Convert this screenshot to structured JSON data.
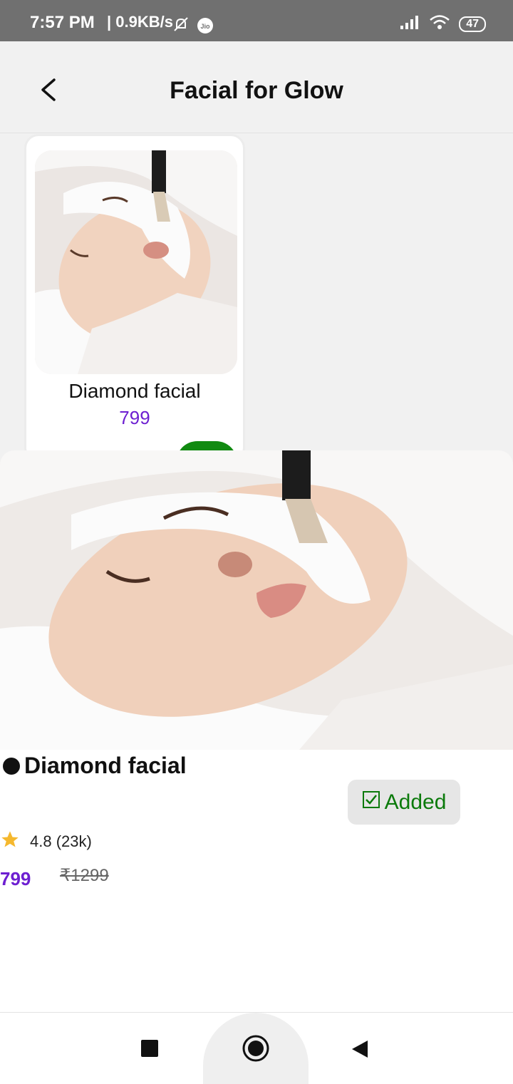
{
  "status_bar": {
    "time": "7:57 PM",
    "network_speed": "| 0.9KB/s",
    "battery": "47"
  },
  "app_bar": {
    "title": "Facial for Glow"
  },
  "service_card": {
    "name": "Diamond facial",
    "price": "799"
  },
  "detail": {
    "name": "Diamond facial",
    "added_label": "Added",
    "rating": "4.8 (23k)",
    "price": "799",
    "original_price": "₹1299"
  },
  "colors": {
    "accent_purple": "#6d1fd1",
    "added_green": "#0b7a0b",
    "card_add_green": "#118a11",
    "star": "#f5b82e"
  },
  "icons": [
    "back-arrow-icon",
    "mute-bell-icon",
    "jio-icon",
    "signal-icon",
    "wifi-icon",
    "star-icon",
    "check-box-icon",
    "nav-recents-icon",
    "nav-home-icon",
    "nav-back-icon"
  ]
}
